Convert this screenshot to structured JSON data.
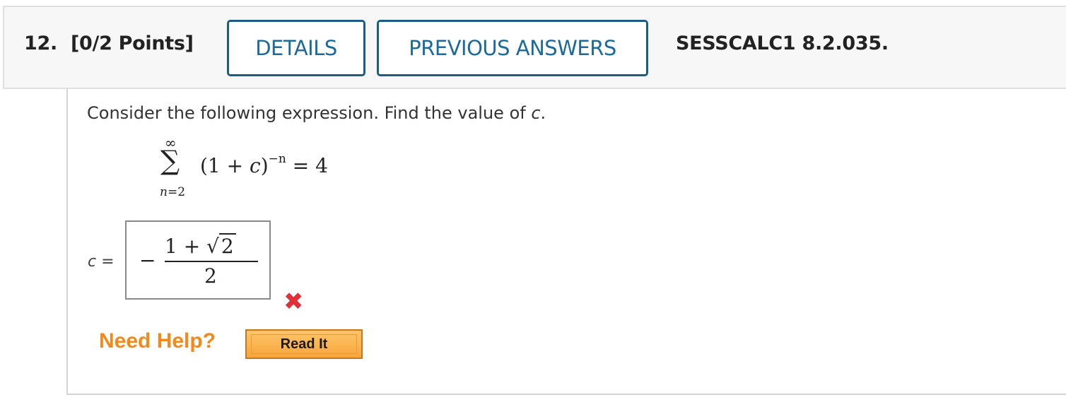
{
  "header": {
    "question_number": "12.",
    "points": "[0/2 Points]",
    "details_label": "DETAILS",
    "previous_answers_label": "PREVIOUS ANSWERS",
    "reference": "SESSCALC1 8.2.035."
  },
  "question": {
    "prompt_before": "Consider the following expression. Find the value of ",
    "prompt_var": "c",
    "prompt_after": ".",
    "sum_upper": "∞",
    "sum_symbol": "∑",
    "sum_lower_var": "n",
    "sum_lower_eq": "=2",
    "sum_body_open": "(1 + ",
    "sum_body_var": "c",
    "sum_body_close": ")",
    "sum_exponent": "−n",
    "sum_equals": " = 4"
  },
  "answer": {
    "label_var": "c",
    "label_eq": " =",
    "minus": "−",
    "numerator": "1 + ",
    "sqrt_symbol": "√",
    "sqrt_arg": "2",
    "denominator": "2",
    "status_mark": "✖"
  },
  "help": {
    "need_help_label": "Need Help?",
    "read_it_label": "Read It"
  },
  "colors": {
    "button_border": "#1b5c85",
    "button_text": "#1b6a9c",
    "wrong": "#e0313b",
    "help_text": "#f08a1c",
    "read_it_bg": "#f7a53c"
  }
}
